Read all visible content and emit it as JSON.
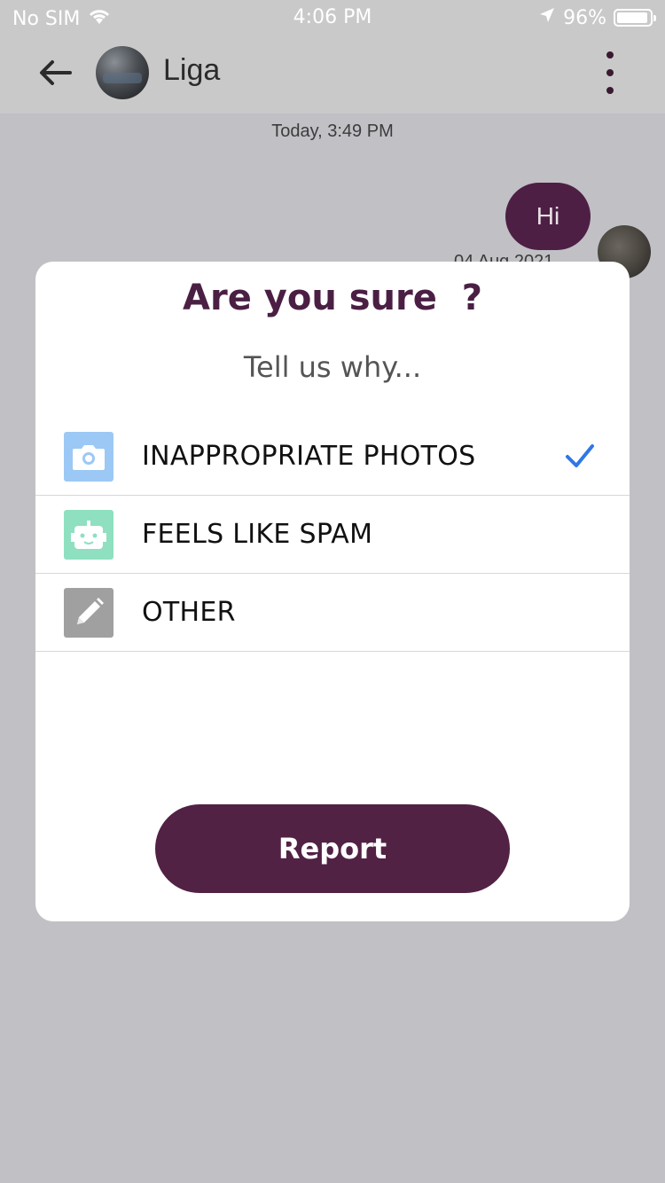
{
  "status_bar": {
    "carrier": "No SIM",
    "time": "4:06 PM",
    "battery": "96%"
  },
  "header": {
    "contact_name": "Liga"
  },
  "chat": {
    "date_divider": "Today, 3:49 PM",
    "message_text": "Hi",
    "message_date": "04 Aug 2021"
  },
  "modal": {
    "title": "Are you sure  ?",
    "subtitle": "Tell us why...",
    "options": [
      {
        "label": "INAPPROPRIATE PHOTOS",
        "icon": "camera-icon",
        "color": "#9cc8f5",
        "selected": true
      },
      {
        "label": "FEELS LIKE SPAM",
        "icon": "robot-icon",
        "color": "#8ee0c0",
        "selected": false
      },
      {
        "label": "OTHER",
        "icon": "pencil-icon",
        "color": "#a0a0a0",
        "selected": false
      }
    ],
    "report_label": "Report"
  },
  "colors": {
    "accent": "#512244",
    "check": "#2f77e4",
    "overlay": "#c1c0c5"
  }
}
